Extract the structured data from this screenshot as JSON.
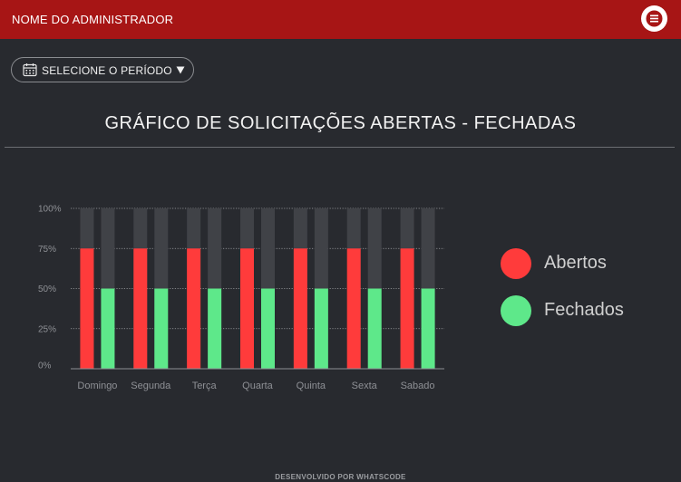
{
  "header": {
    "admin_name": "NOME DO ADMINISTRADOR",
    "menu_icon": "menu-icon"
  },
  "period_selector": {
    "label": "SELECIONE O PERÍODO",
    "icon": "calendar-icon",
    "caret": "caret-down-icon"
  },
  "chart_title": "GRÁFICO DE SOLICITAÇÕES ABERTAS - FECHADAS",
  "colors": {
    "header_bg": "#a71515",
    "page_bg": "#282a2f",
    "abertos": "#ff3b3b",
    "fechados": "#5ee88a",
    "track": "#404247"
  },
  "chart_data": {
    "type": "bar",
    "categories": [
      "Domingo",
      "Segunda",
      "Terça",
      "Quarta",
      "Quinta",
      "Sexta",
      "Sabado"
    ],
    "series": [
      {
        "name": "Abertos",
        "values": [
          75,
          75,
          75,
          75,
          75,
          75,
          75
        ]
      },
      {
        "name": "Fechados",
        "values": [
          50,
          50,
          50,
          50,
          50,
          50,
          50
        ]
      }
    ],
    "y_ticks": [
      "100%",
      "75%",
      "50%",
      "25%",
      "0%"
    ],
    "ylim": [
      0,
      100
    ],
    "grid": true,
    "legend_position": "right"
  },
  "legend": [
    {
      "label": "Abertos"
    },
    {
      "label": "Fechados"
    }
  ],
  "footer": "DESENVOLVIDO POR WHATSCODE"
}
